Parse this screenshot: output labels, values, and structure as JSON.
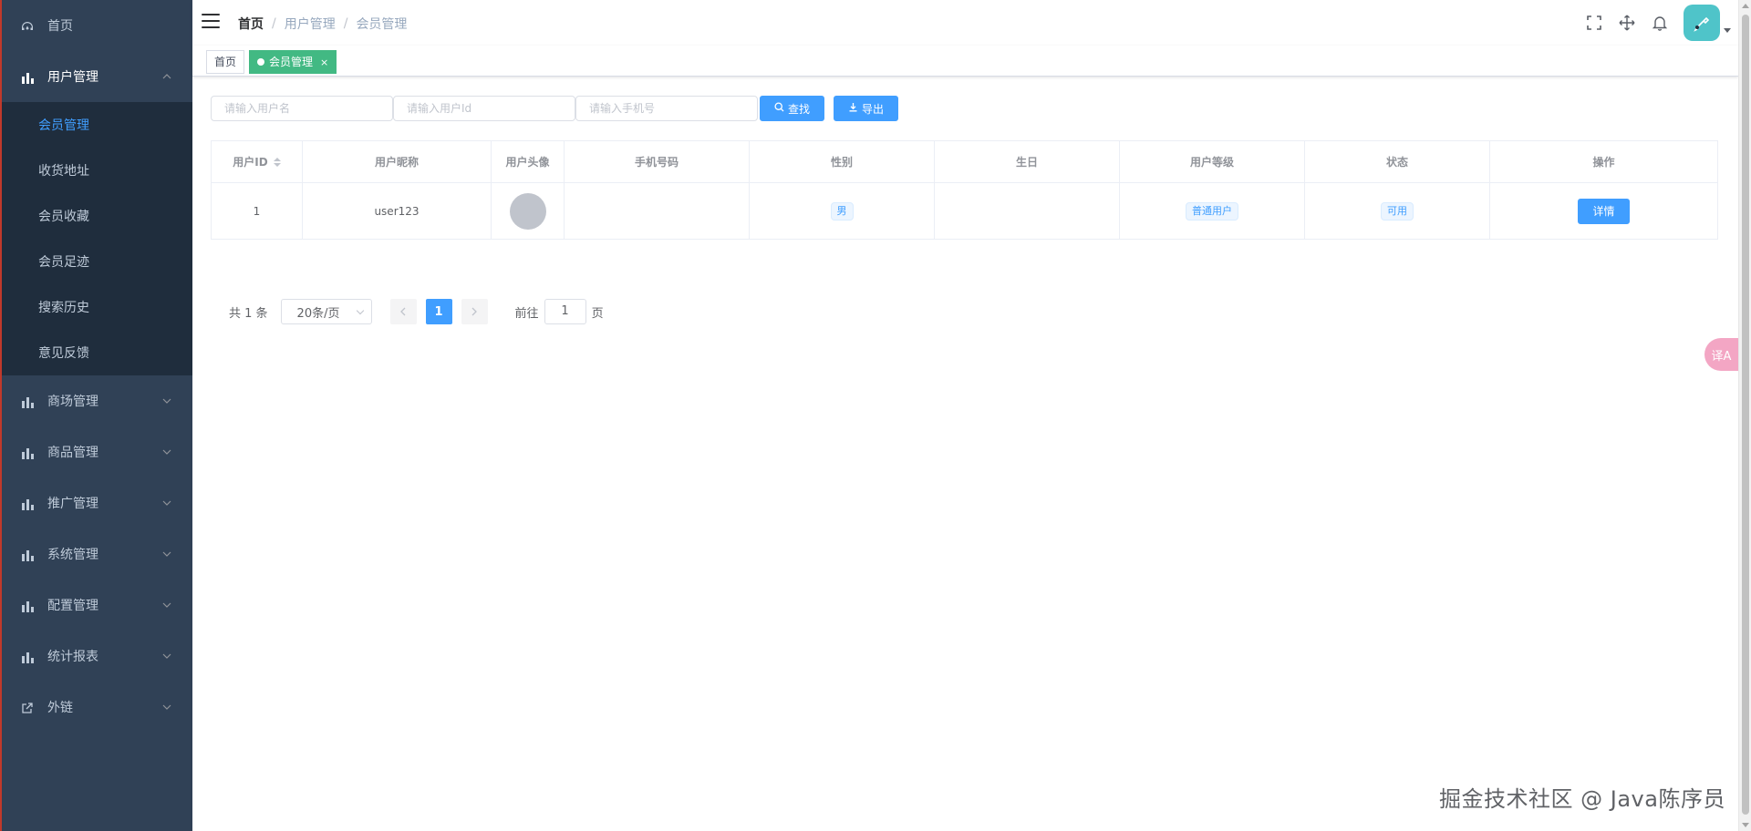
{
  "sidebar": {
    "top_items": [
      {
        "label": "首页",
        "icon": "dashboard-icon"
      }
    ],
    "open_group": {
      "label": "用户管理",
      "icon": "chart-icon"
    },
    "sub_items": [
      {
        "label": "会员管理",
        "active": true
      },
      {
        "label": "收货地址"
      },
      {
        "label": "会员收藏"
      },
      {
        "label": "会员足迹"
      },
      {
        "label": "搜索历史"
      },
      {
        "label": "意见反馈"
      }
    ],
    "groups": [
      {
        "label": "商场管理",
        "icon": "chart-icon"
      },
      {
        "label": "商品管理",
        "icon": "chart-icon"
      },
      {
        "label": "推广管理",
        "icon": "chart-icon"
      },
      {
        "label": "系统管理",
        "icon": "chart-icon"
      },
      {
        "label": "配置管理",
        "icon": "chart-icon"
      },
      {
        "label": "统计报表",
        "icon": "chart-icon"
      },
      {
        "label": "外链",
        "icon": "external-link-icon"
      }
    ],
    "active_color": "#409eff",
    "background": "#304156"
  },
  "navbar": {
    "breadcrumb": [
      "首页",
      "用户管理",
      "会员管理"
    ],
    "separator": "/",
    "icons": [
      "fullscreen-icon",
      "move-icon",
      "bell-icon"
    ]
  },
  "tags_view": {
    "tags": [
      {
        "label": "首页",
        "active": false
      },
      {
        "label": "会员管理",
        "active": true,
        "close": "×"
      }
    ]
  },
  "filter": {
    "username_placeholder": "请输入用户名",
    "userid_placeholder": "请输入用户Id",
    "phone_placeholder": "请输入手机号",
    "search_label": "查找",
    "export_label": "导出"
  },
  "table": {
    "headers": [
      "用户ID",
      "用户昵称",
      "用户头像",
      "手机号码",
      "性别",
      "生日",
      "用户等级",
      "状态",
      "操作"
    ],
    "rows": [
      {
        "id": "1",
        "nickname": "user123",
        "phone": "",
        "gender": "男",
        "birthday": "",
        "level": "普通用户",
        "status": "可用",
        "action": "详情"
      }
    ]
  },
  "pagination": {
    "total_text": "共 1 条",
    "page_size": "20条/页",
    "current_page": "1",
    "goto_label": "前往",
    "goto_value": "1",
    "page_suffix": "页"
  },
  "translate_fab": "译A",
  "watermark": "掘金技术社区 @ Java陈序员",
  "colors": {
    "primary": "#409eff",
    "tag_active": "#42b983",
    "avatar_bg": "#4fc4c9"
  }
}
